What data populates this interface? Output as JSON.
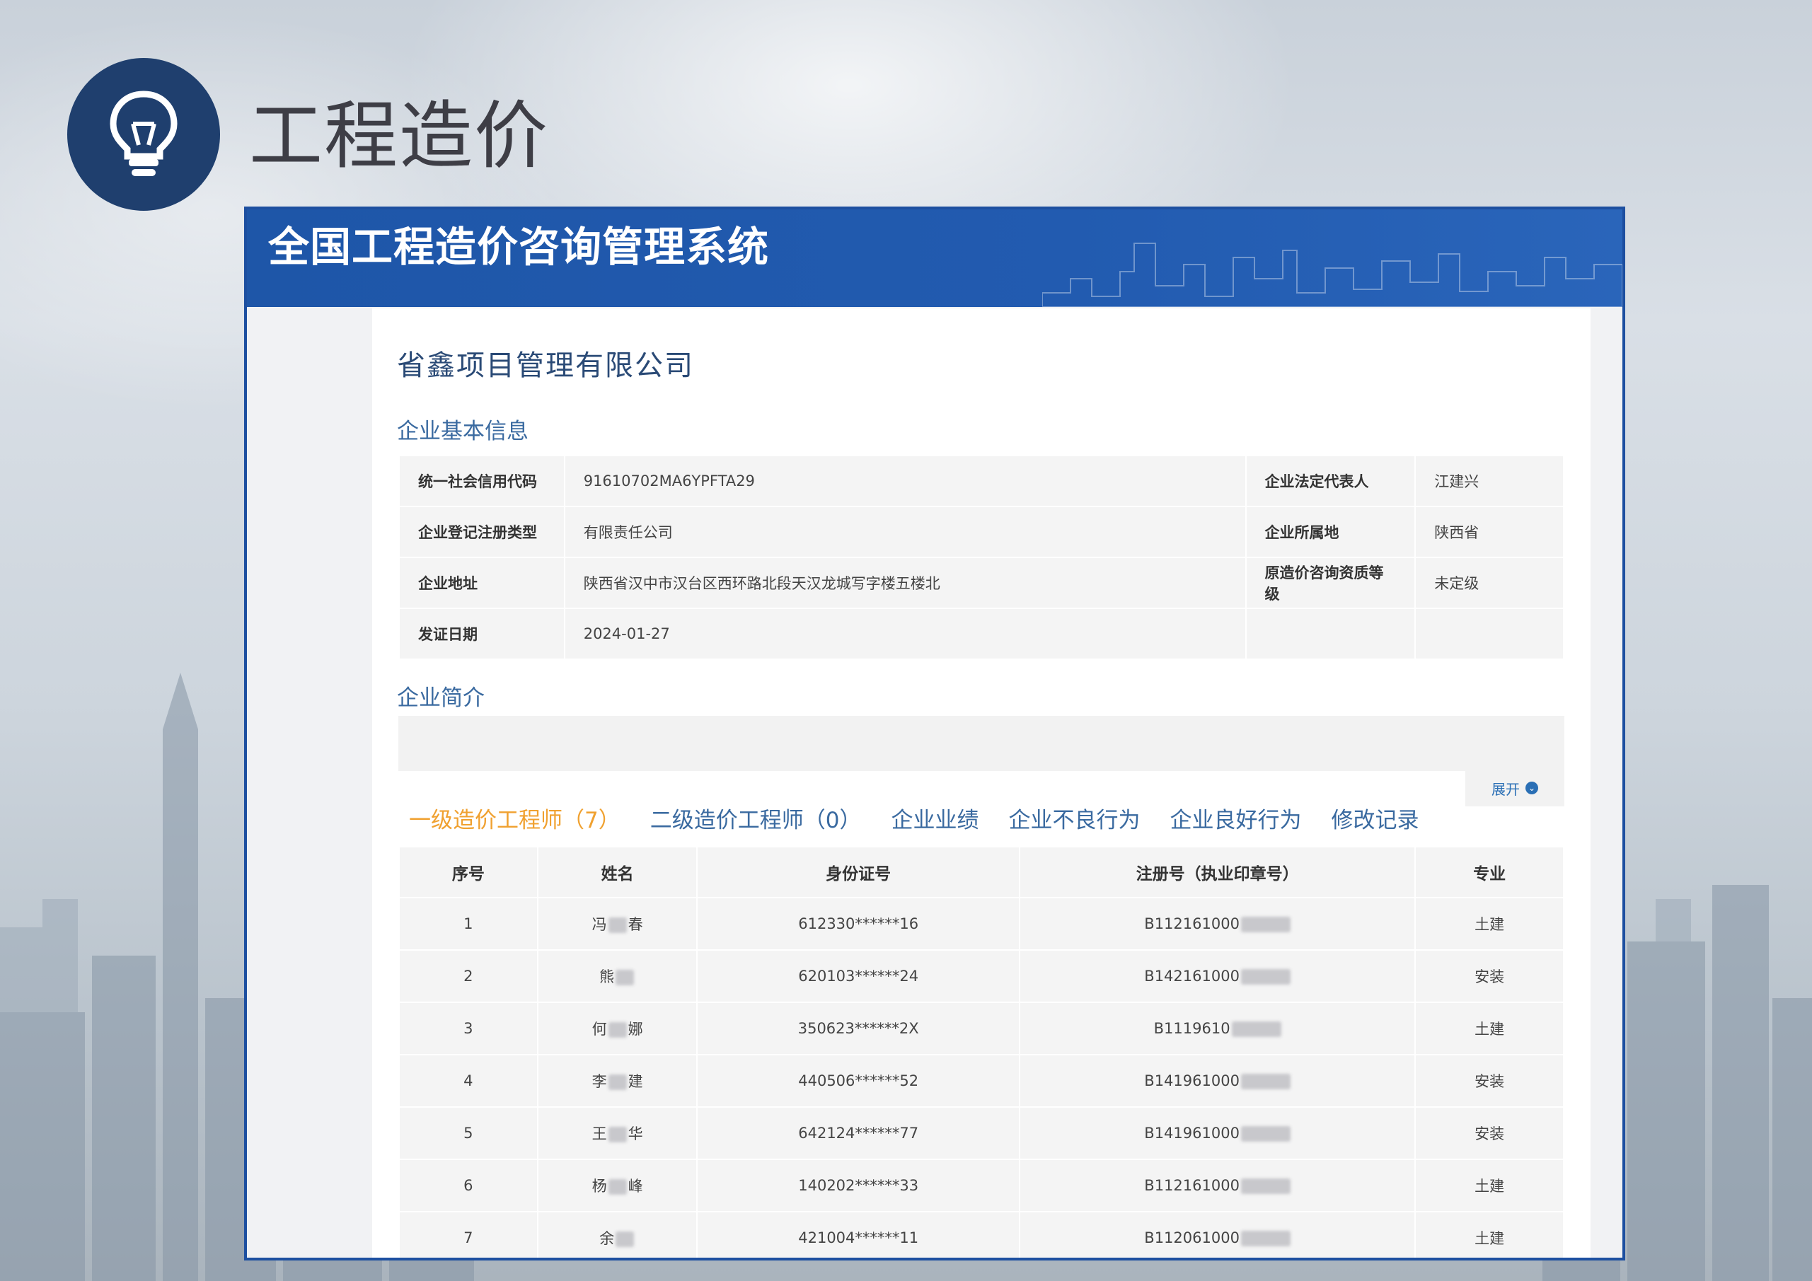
{
  "slide": {
    "heading": "工程造价",
    "icon": "lightbulb-icon"
  },
  "system": {
    "title": "全国工程造价咨询管理系统"
  },
  "company": {
    "name": "省鑫项目管理有限公司"
  },
  "basic_info": {
    "section_title": "企业基本信息",
    "rows": [
      {
        "k1": "统一社会信用代码",
        "v1": "91610702MA6YPFTA29",
        "k2": "企业法定代表人",
        "v2": "江建兴"
      },
      {
        "k1": "企业登记注册类型",
        "v1": "有限责任公司",
        "k2": "企业所属地",
        "v2": "陕西省"
      },
      {
        "k1": "企业地址",
        "v1": "陕西省汉中市汉台区西环路北段天汉龙城写字楼五楼北",
        "k2": "原造价咨询资质等级",
        "v2": "未定级"
      },
      {
        "k1": "发证日期",
        "v1": "2024-01-27",
        "k2": "",
        "v2": ""
      }
    ]
  },
  "intro": {
    "section_title": "企业简介",
    "expand_label": "展开"
  },
  "tabs": [
    {
      "label": "一级造价工程师（7）",
      "active": true
    },
    {
      "label": "二级造价工程师（0）",
      "active": false
    },
    {
      "label": "企业业绩",
      "active": false
    },
    {
      "label": "企业不良行为",
      "active": false
    },
    {
      "label": "企业良好行为",
      "active": false
    },
    {
      "label": "修改记录",
      "active": false
    }
  ],
  "staff_table": {
    "headers": [
      "序号",
      "姓名",
      "身份证号",
      "注册号（执业印章号）",
      "专业"
    ],
    "rows": [
      {
        "no": "1",
        "name_a": "冯",
        "name_b": "春",
        "id": "612330******16",
        "reg": "B112161000",
        "major": "土建"
      },
      {
        "no": "2",
        "name_a": "熊",
        "name_b": "",
        "id": "620103******24",
        "reg": "B142161000",
        "major": "安装"
      },
      {
        "no": "3",
        "name_a": "何",
        "name_b": "娜",
        "id": "350623******2X",
        "reg": "B1119610",
        "major": "土建"
      },
      {
        "no": "4",
        "name_a": "李",
        "name_b": "建",
        "id": "440506******52",
        "reg": "B141961000",
        "major": "安装"
      },
      {
        "no": "5",
        "name_a": "王",
        "name_b": "华",
        "id": "642124******77",
        "reg": "B141961000",
        "major": "安装"
      },
      {
        "no": "6",
        "name_a": "杨",
        "name_b": "峰",
        "id": "140202******33",
        "reg": "B112161000",
        "major": "土建"
      },
      {
        "no": "7",
        "name_a": "余",
        "name_b": "",
        "id": "421004******11",
        "reg": "B112061000",
        "major": "土建"
      }
    ]
  },
  "colors": {
    "brand_blue": "#1e56a8",
    "tab_active": "#f0a130",
    "tab_text": "#3a6aa0",
    "icon_circle": "#1f3f6e"
  }
}
